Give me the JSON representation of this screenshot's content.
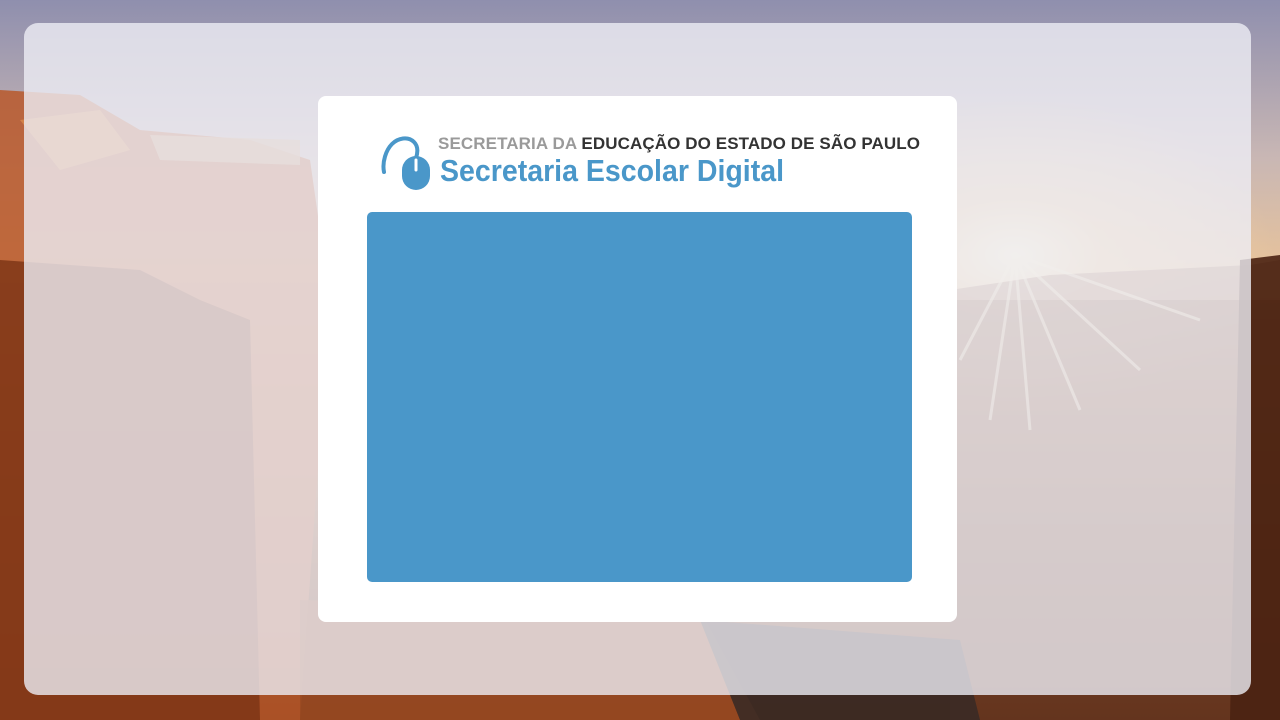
{
  "brand": {
    "line1_prefix": "SECRETARIA DA",
    "line1_main": "EDUCAÇÃO DO ESTADO DE SÃO PAULO",
    "line2": "Secretaria Escolar Digital",
    "icon": "mouse-icon"
  },
  "colors": {
    "brand_blue": "#4a97c9",
    "muted_gray": "#9a9a9a",
    "dark_text": "#333333",
    "card_bg": "#ffffff"
  }
}
